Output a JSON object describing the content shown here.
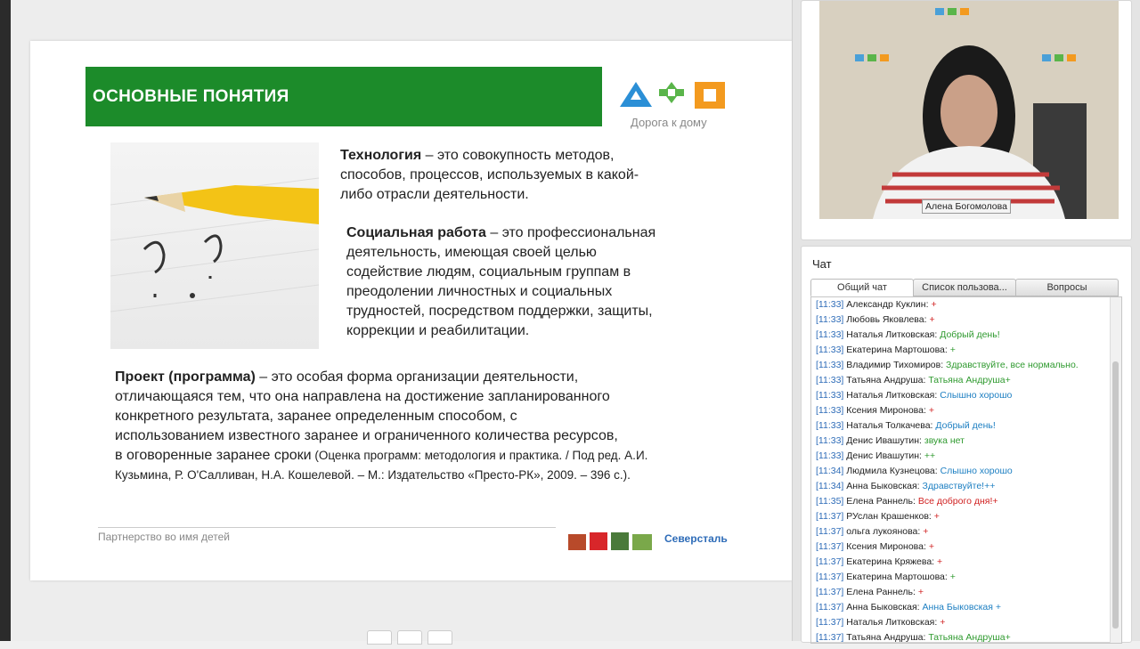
{
  "slide": {
    "title": "ОСНОВНЫЕ ПОНЯТИЯ",
    "logo_caption": "Дорога к дому",
    "p1_term": "Технология",
    "p1_line1": " – это совокупность методов,",
    "p1_line2": "способов, процессов, используемых в какой-",
    "p1_line3": "либо отрасли деятельности.",
    "p2_term": "Социальная работа",
    "p2_line1": " – это профессиональная",
    "p2_line2": "деятельность, имеющая своей целью",
    "p2_line3": "содействие людям, социальным группам в",
    "p2_line4": "преодолении личностных и социальных",
    "p2_line5": "трудностей, посредством поддержки, защиты,",
    "p2_line6": "коррекции и реабилитации.",
    "p3_term": "Проект (программа)",
    "p3_line1": " – это особая форма организации деятельности,",
    "p3_line2": "отличающаяся тем, что  она направлена на достижение запланированного",
    "p3_line3": "конкретного результата, заранее определенным способом, с",
    "p3_line4": "использованием известного заранее и ограниченного количества ресурсов,",
    "p3_line5": "в оговоренные заранее сроки",
    "p3_cite1": " (Оценка программ: методология и практика. / Под ред. А.И.",
    "p3_cite2": "Кузьмина, Р. О'Салливан, Н.А. Кошелевой.  – М.: Издательство «Престо-РК», 2009. – 396 с.).",
    "footer": "Партнерство во имя детей",
    "sponsor": "Северсталь"
  },
  "video": {
    "speaker_name": "Алена Богомолова"
  },
  "chat": {
    "title": "Чат",
    "tabs": [
      "Общий чат",
      "Список пользова...",
      "Вопросы"
    ],
    "messages": [
      {
        "time": "[11:33]",
        "user": "Александр Куклин:",
        "text": "+",
        "color": "red"
      },
      {
        "time": "[11:33]",
        "user": "Любовь Яковлева:",
        "text": "+",
        "color": "red"
      },
      {
        "time": "[11:33]",
        "user": "Наталья Литковская:",
        "text": "Добрый день!",
        "color": "green"
      },
      {
        "time": "[11:33]",
        "user": "Екатерина Мартошова:",
        "text": "+",
        "color": "green"
      },
      {
        "time": "[11:33]",
        "user": "Владимир Тихомиров:",
        "text": "Здравствуйте, все нормально.",
        "color": "green"
      },
      {
        "time": "[11:33]",
        "user": "Татьяна Андруша:",
        "text": "Татьяна Андруша+",
        "color": "green"
      },
      {
        "time": "[11:33]",
        "user": "Наталья Литковская:",
        "text": "Слышно хорошо",
        "color": "blue"
      },
      {
        "time": "[11:33]",
        "user": "Ксения Миронова:",
        "text": "+",
        "color": "red"
      },
      {
        "time": "[11:33]",
        "user": "Наталья Толкачева:",
        "text": "Добрый день!",
        "color": "blue"
      },
      {
        "time": "[11:33]",
        "user": "Денис Ивашутин:",
        "text": "звука нет",
        "color": "green"
      },
      {
        "time": "[11:33]",
        "user": "Денис Ивашутин:",
        "text": "++",
        "color": "green"
      },
      {
        "time": "[11:34]",
        "user": "Людмила Кузнецова:",
        "text": "Слышно хорошо",
        "color": "blue"
      },
      {
        "time": "[11:34]",
        "user": "Анна Быковская:",
        "text": "Здравствуйте!++",
        "color": "blue"
      },
      {
        "time": "[11:35]",
        "user": "Елена Раннель:",
        "text": "Все доброго дня!+",
        "color": "red"
      },
      {
        "time": "[11:37]",
        "user": "РУслан Крашенков:",
        "text": "+",
        "color": "red"
      },
      {
        "time": "[11:37]",
        "user": "ольга лукоянова:",
        "text": "+",
        "color": "red"
      },
      {
        "time": "[11:37]",
        "user": "Ксения Миронова:",
        "text": "+",
        "color": "red"
      },
      {
        "time": "[11:37]",
        "user": "Екатерина Кряжева:",
        "text": "+",
        "color": "red"
      },
      {
        "time": "[11:37]",
        "user": "Екатерина Мартошова:",
        "text": "+",
        "color": "green"
      },
      {
        "time": "[11:37]",
        "user": "Елена Раннель:",
        "text": "+",
        "color": "red"
      },
      {
        "time": "[11:37]",
        "user": "Анна Быковская:",
        "text": "Анна Быковская +",
        "color": "blue"
      },
      {
        "time": "[11:37]",
        "user": "Наталья Литковская:",
        "text": "+",
        "color": "red"
      },
      {
        "time": "[11:37]",
        "user": "Татьяна Андруша:",
        "text": "Татьяна Андруша+",
        "color": "green"
      }
    ]
  },
  "colors": {
    "title_bar": "#1c8b2a",
    "time": "#2e6cb8",
    "msg_blue": "#1d7fc2",
    "msg_green": "#2f9a2f",
    "msg_red": "#d02020"
  }
}
